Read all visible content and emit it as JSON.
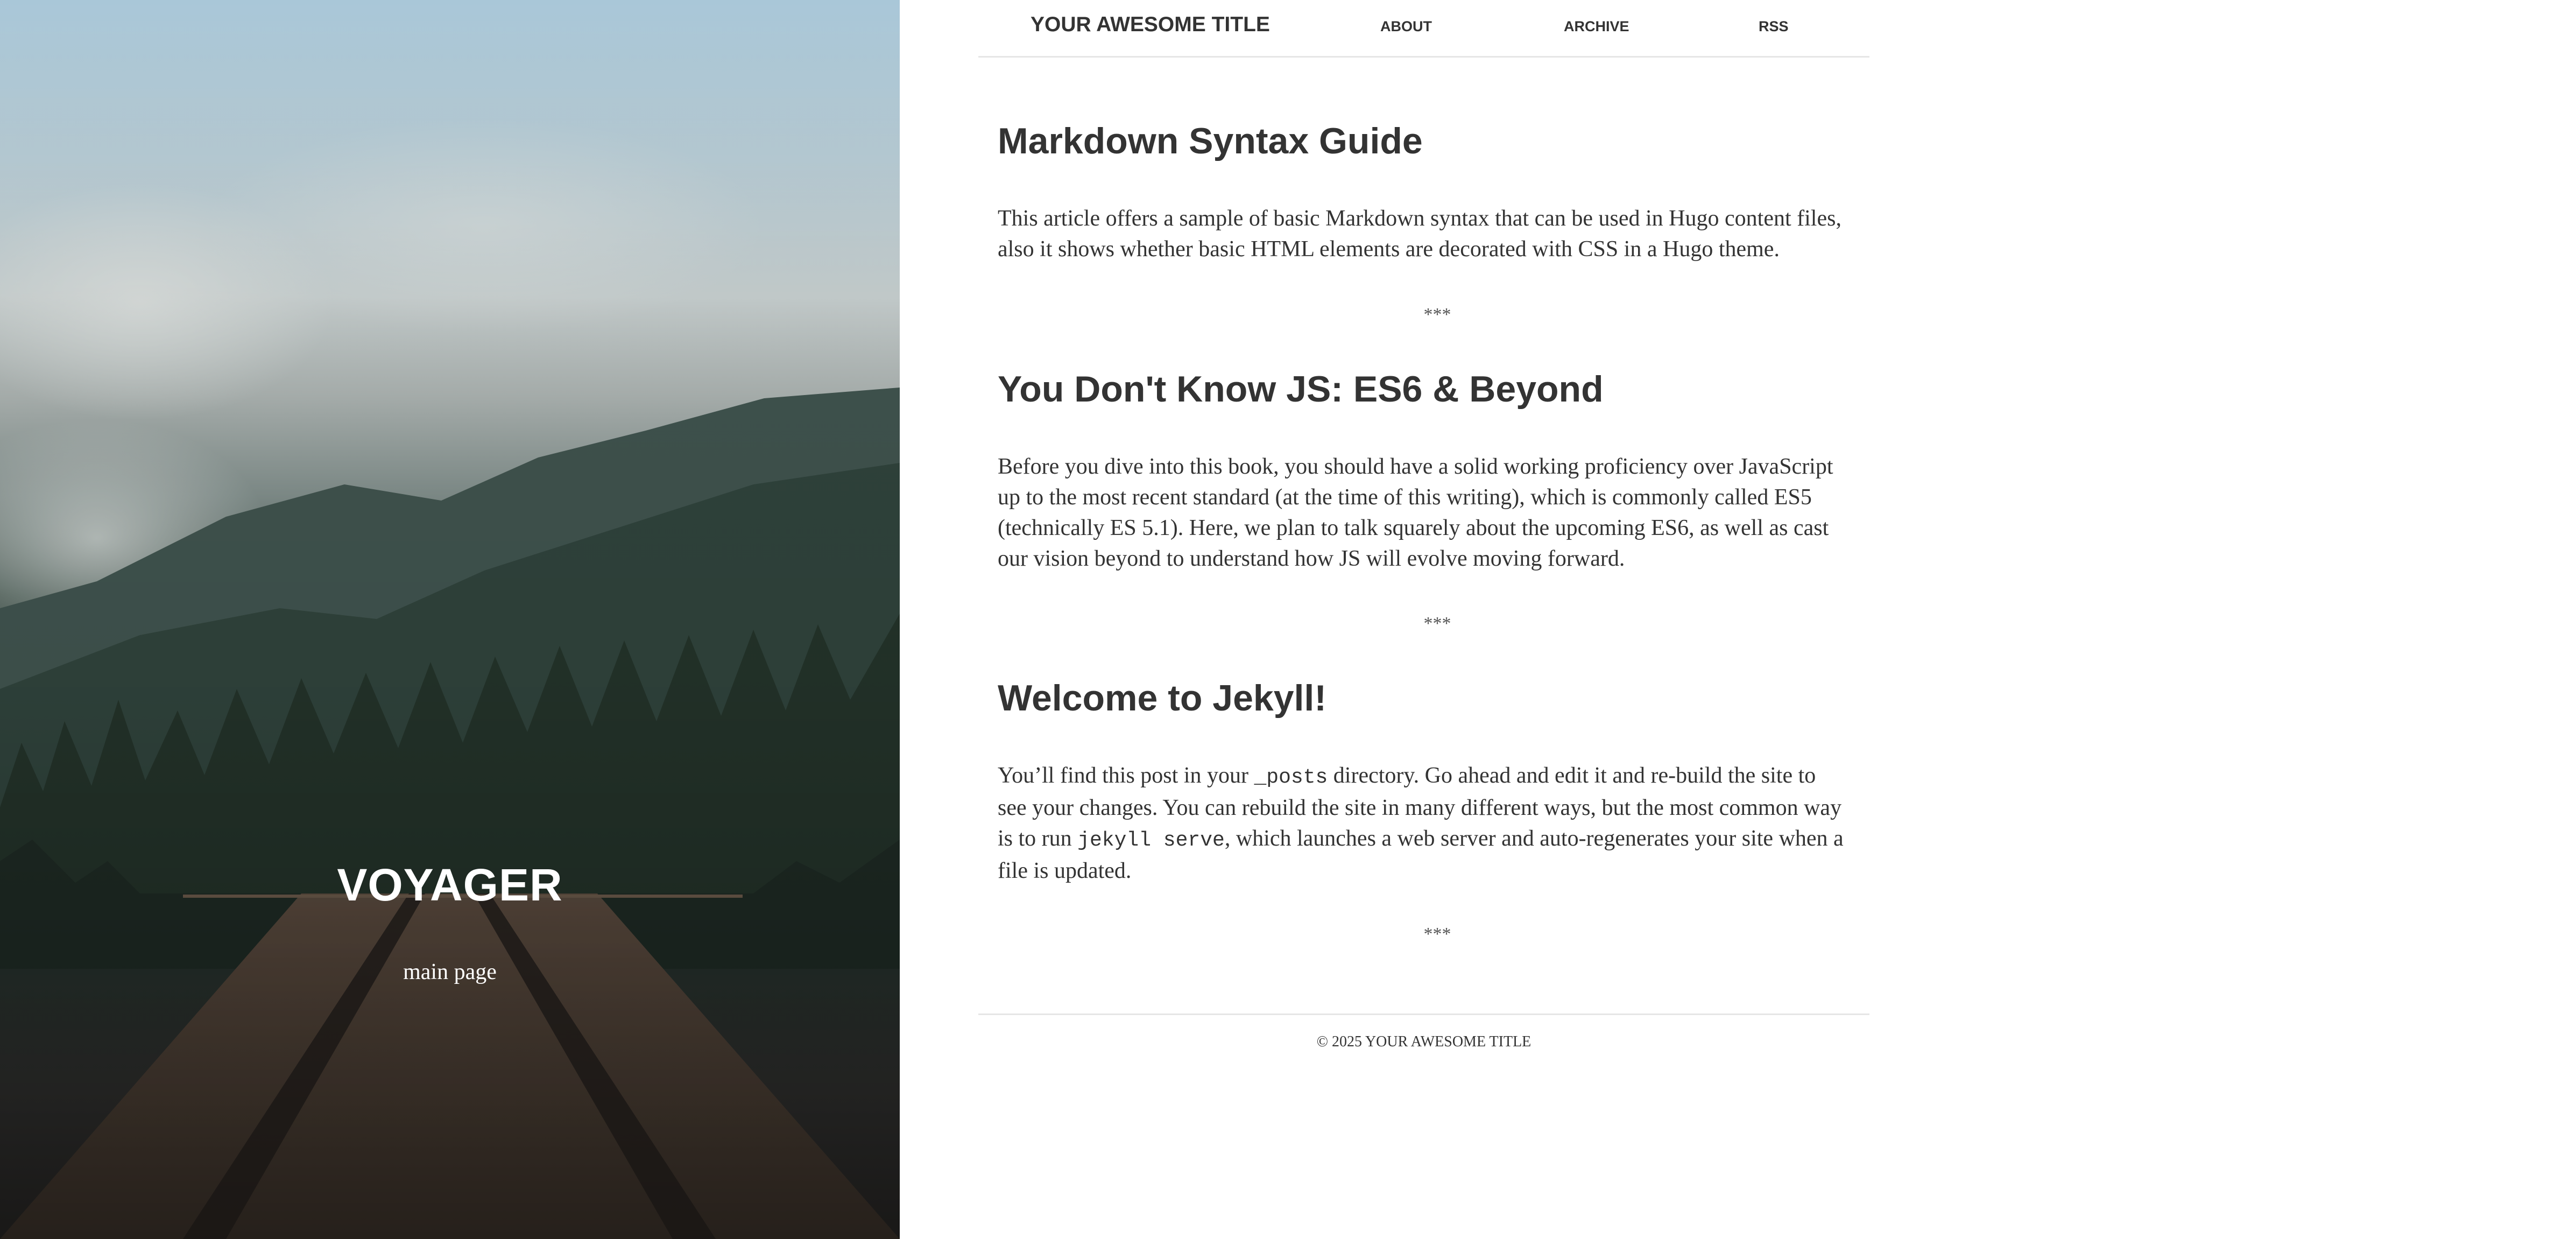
{
  "hero": {
    "title": "VOYAGER",
    "subtitle": "main page"
  },
  "header": {
    "site_title": "YOUR AWESOME TITLE",
    "nav": [
      {
        "label": "ABOUT"
      },
      {
        "label": "ARCHIVE"
      },
      {
        "label": "RSS"
      }
    ]
  },
  "posts": [
    {
      "title": "Markdown Syntax Guide",
      "summary": "This article offers a sample of basic Markdown syntax that can be used in Hugo content files, also it shows whether basic HTML elements are decorated with CSS in a Hugo theme."
    },
    {
      "title": "You Don't Know JS: ES6 & Beyond",
      "summary": "Before you dive into this book, you should have a solid working proficiency over JavaScript up to the most recent standard (at the time of this writing), which is commonly called ES5 (technically ES 5.1). Here, we plan to talk squarely about the upcoming ES6, as well as cast our vision beyond to understand how JS will evolve moving forward."
    },
    {
      "title": "Welcome to Jekyll!",
      "summary_parts": [
        "You’ll find this post in your ",
        "_posts",
        " directory. Go ahead and edit it and re-build the site to see your changes. You can rebuild the site in many different ways, but the most common way is to run ",
        "jekyll serve",
        ", which launches a web server and auto-regenerates your site when a file is updated."
      ]
    }
  ],
  "separator": "***",
  "footer": {
    "text": "© 2025 YOUR AWESOME TITLE"
  },
  "colors": {
    "text": "#333333",
    "background": "#ffffff",
    "rule": "#e6e6e6"
  }
}
